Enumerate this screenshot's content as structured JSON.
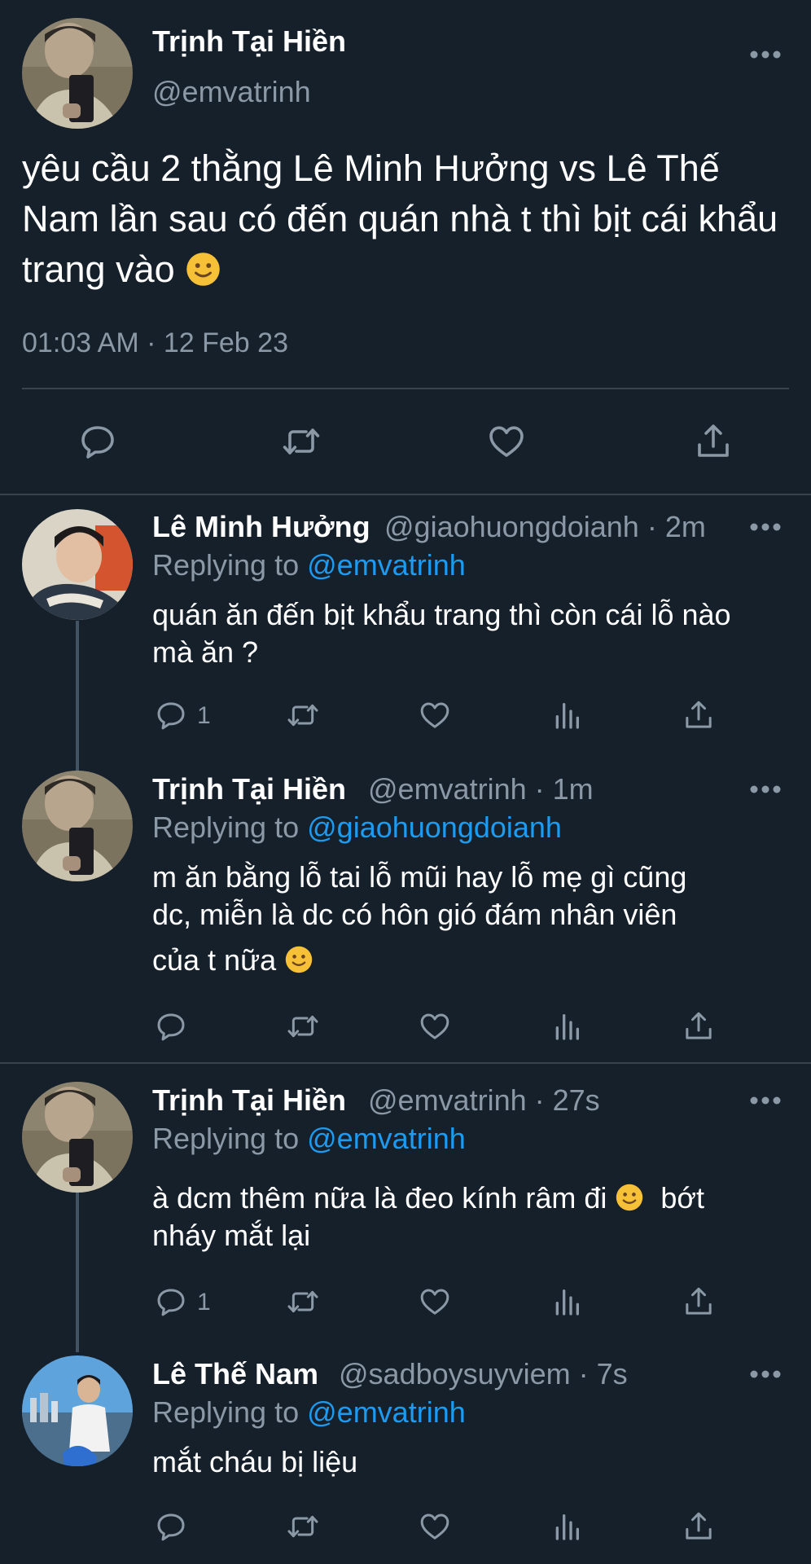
{
  "main_tweet": {
    "author_name": "Trịnh Tại Hiền",
    "author_handle": "@emvatrinh",
    "text": "yêu cầu 2 thằng Lê Minh Hưởng vs Lê Thế Nam lần sau có đến quán nhà t thì bịt cái khẩu trang vào",
    "emoji": "slightly-smiling-face",
    "timestamp": "01:03 AM · 12 Feb 23"
  },
  "replies": [
    {
      "author_name": "Lê Minh Hưởng",
      "author_meta": "@giaohuongdoianh · 2m",
      "replying_prefix": "Replying to",
      "replying_to": "@emvatrinh",
      "text": "quán ăn đến bịt khẩu trang thì còn cái lỗ nào mà ăn ?",
      "reply_count": "1"
    },
    {
      "author_name": "Trịnh Tại Hiền",
      "author_meta": "@emvatrinh · 1m",
      "replying_prefix": "Replying to",
      "replying_to": "@giaohuongdoianh",
      "text_line1": "m ăn bằng lỗ tai lỗ mũi hay lỗ mẹ gì cũng",
      "text_line2": "dc, miễn là dc có hôn gió đám nhân viên",
      "text_line3": "của t nữa",
      "reply_count": ""
    },
    {
      "author_name": "Trịnh Tại Hiền",
      "author_meta": "@emvatrinh · 27s",
      "replying_prefix": "Replying to",
      "replying_to": "@emvatrinh",
      "text_part1": "à dcm thêm nữa là đeo kính râm đi",
      "text_part2": "bớt",
      "text_line2": "nháy mắt lại",
      "reply_count": "1"
    },
    {
      "author_name": "Lê Thế Nam",
      "author_meta": "@sadboysuyviem · 7s",
      "replying_prefix": "Replying to",
      "replying_to": "@emvatrinh",
      "text": "mắt cháu bị liệu",
      "reply_count": ""
    }
  ],
  "icons": {
    "reply": "reply-icon",
    "retweet": "retweet-icon",
    "like": "like-icon",
    "views": "views-icon",
    "share": "share-icon",
    "more": "more-icon"
  },
  "colors": {
    "background": "#15202b",
    "text": "#ffffff",
    "muted": "#8b98a5",
    "mention": "#1d9bf0",
    "divider": "#38444d"
  }
}
